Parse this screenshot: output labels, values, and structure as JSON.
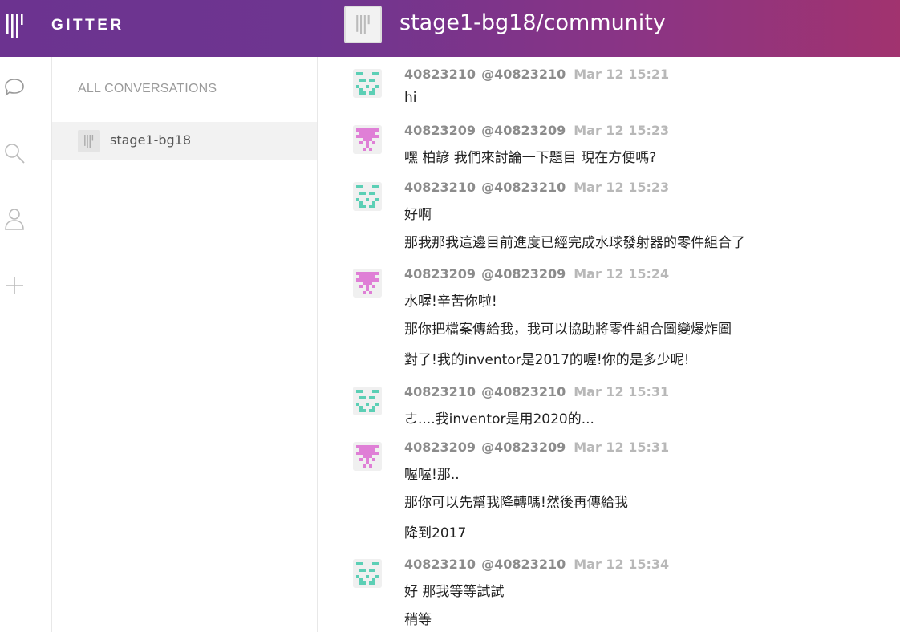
{
  "header": {
    "brand": "GITTER",
    "room_title": "stage1-bg18/community"
  },
  "rail": {
    "icons": [
      "chat-bubble-icon",
      "search-icon",
      "person-icon",
      "plus-icon"
    ]
  },
  "conversations": {
    "heading": "ALL CONVERSATIONS",
    "items": [
      {
        "label": "stage1-bg18"
      }
    ]
  },
  "colors": {
    "avatar_teal": "#5ccfb5",
    "avatar_pink": "#df7fd6"
  },
  "messages": [
    {
      "user": "40823210",
      "handle": "@40823210",
      "time": "Mar 12 15:21",
      "avatar": "teal",
      "lines": [
        "hi"
      ]
    },
    {
      "user": "40823209",
      "handle": "@40823209",
      "time": "Mar 12 15:23",
      "avatar": "pink",
      "lines": [
        "嘿 柏諺 我們來討論一下題目 現在方便嗎?"
      ]
    },
    {
      "user": "40823210",
      "handle": "@40823210",
      "time": "Mar 12 15:23",
      "avatar": "teal",
      "lines": [
        "好啊",
        "那我那我這邊目前進度已經完成水球發射器的零件組合了"
      ]
    },
    {
      "user": "40823209",
      "handle": "@40823209",
      "time": "Mar 12 15:24",
      "avatar": "pink",
      "lines": [
        "水喔!辛苦你啦!",
        "那你把檔案傳給我，我可以協助將零件組合圖變爆炸圖",
        "對了!我的inventor是2017的喔!你的是多少呢!"
      ]
    },
    {
      "user": "40823210",
      "handle": "@40823210",
      "time": "Mar 12 15:31",
      "avatar": "teal",
      "lines": [
        "ㄜ....我inventor是用2020的..."
      ]
    },
    {
      "user": "40823209",
      "handle": "@40823209",
      "time": "Mar 12 15:31",
      "avatar": "pink",
      "lines": [
        "喔喔!那..",
        "那你可以先幫我降轉嗎!然後再傳給我",
        "降到2017"
      ]
    },
    {
      "user": "40823210",
      "handle": "@40823210",
      "time": "Mar 12 15:34",
      "avatar": "teal",
      "lines": [
        "好 那我等等試試",
        "稍等"
      ]
    }
  ]
}
